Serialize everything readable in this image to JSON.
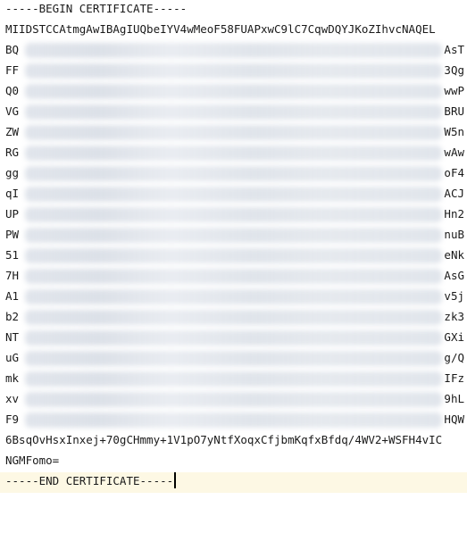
{
  "editor": {
    "header_line": "-----BEGIN CERTIFICATE-----",
    "footer_line": "-----END CERTIFICATE-----",
    "lines": [
      {
        "visible": "MIIDSTCCAtmgAwIBAgIUQbeIYV4wMeoF58FUAPxwC9lC7CqwDQYJKoZIhvcNAQEL",
        "left": "",
        "right": ""
      },
      {
        "left": "BQ",
        "right": "AsT"
      },
      {
        "left": "FF",
        "right": "3Qg"
      },
      {
        "left": "Q0",
        "right": "wwP"
      },
      {
        "left": "VG",
        "right": "BRU"
      },
      {
        "left": "ZW",
        "right": "W5n"
      },
      {
        "left": "RG",
        "right": "wAw"
      },
      {
        "left": "gg",
        "right": "oF4"
      },
      {
        "left": "qI",
        "right": "ACJ"
      },
      {
        "left": "UP",
        "right": "Hn2"
      },
      {
        "left": "PW",
        "right": "nuB"
      },
      {
        "left": "51",
        "right": "eNk"
      },
      {
        "left": "7H",
        "right": "AsG"
      },
      {
        "left": "A1",
        "right": "v5j"
      },
      {
        "left": "b2",
        "right": "zk3"
      },
      {
        "left": "NT",
        "right": "GXi"
      },
      {
        "left": "uG",
        "right": "g/Q"
      },
      {
        "left": "mk",
        "right": "IFz"
      },
      {
        "left": "xv",
        "right": "9hL"
      },
      {
        "left": "F9",
        "right": "HQW"
      }
    ],
    "visible_line_24": "6BsqOvHsxInxej+70gCHmmy+1V1pO7yNtfXoqxCfjbmKqfxBfdq/4WV2+WSFH4vIC",
    "visible_line_25": "NGMFomo="
  }
}
